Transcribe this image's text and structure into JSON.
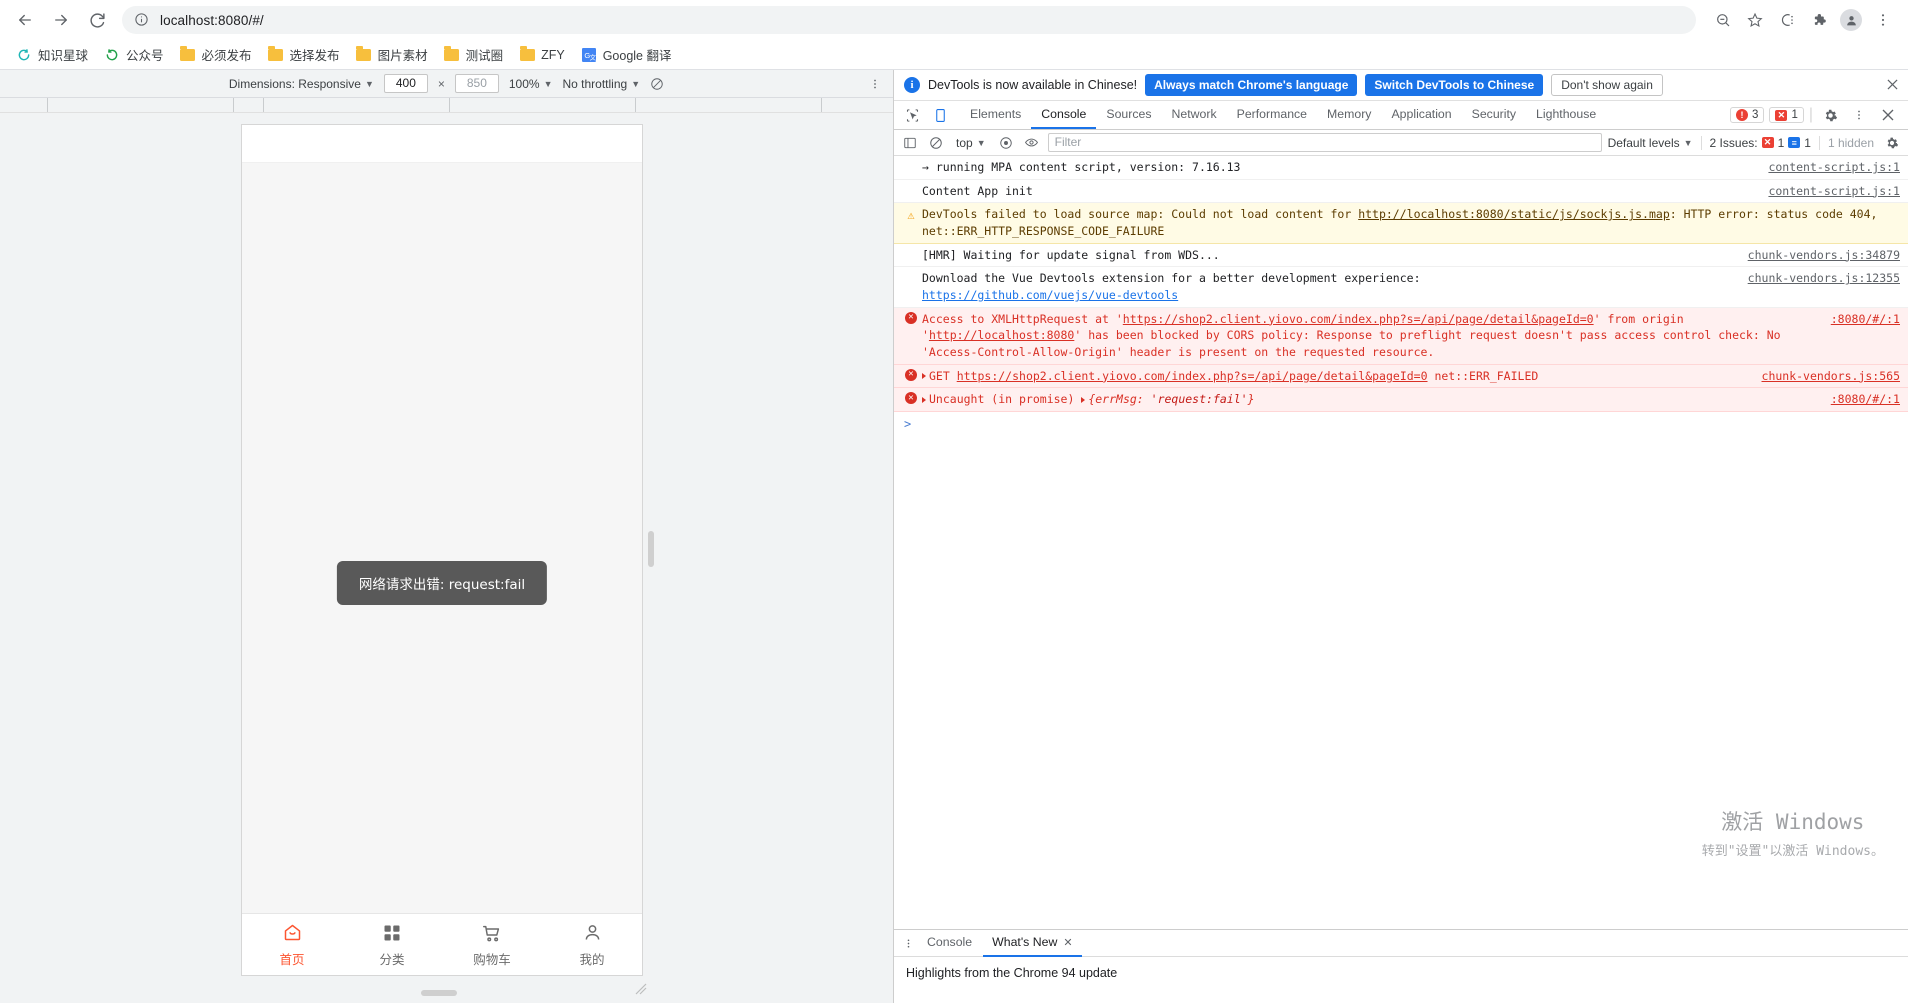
{
  "browser": {
    "back_label": "back-arrow",
    "forward_label": "forward-arrow",
    "reload_label": "reload",
    "url": "localhost:8080/#/",
    "url_host": "localhost:8080",
    "url_path": "/#/",
    "bookmarks": [
      {
        "label": "知识星球",
        "icon": "circle-teal-icon"
      },
      {
        "label": "公众号",
        "icon": "circle-green-icon"
      },
      {
        "label": "必须发布",
        "icon": "folder-icon"
      },
      {
        "label": "选择发布",
        "icon": "folder-icon"
      },
      {
        "label": "图片素材",
        "icon": "folder-icon"
      },
      {
        "label": "测试圈",
        "icon": "folder-icon"
      },
      {
        "label": "ZFY",
        "icon": "folder-icon"
      },
      {
        "label": "Google 翻译",
        "icon": "google-translate-icon"
      }
    ],
    "toolbar_icons": [
      "zoom-out-icon",
      "bookmark-star-icon",
      "extension-badge-icon",
      "puzzle-icon",
      "profile-avatar-icon",
      "chrome-menu-icon"
    ]
  },
  "device_toolbar": {
    "dimensions_label": "Dimensions: Responsive",
    "width": "400",
    "height": "850",
    "x_separator": "×",
    "zoom": "100%",
    "throttling": "No throttling",
    "rotate_icon": "rotate-icon",
    "more_icon": "more-options-icon"
  },
  "phone": {
    "toast": "网络请求出错: request:fail",
    "tabbar": [
      {
        "label": "首页",
        "icon": "home-icon",
        "active": true
      },
      {
        "label": "分类",
        "icon": "grid-icon",
        "active": false
      },
      {
        "label": "购物车",
        "icon": "cart-icon",
        "active": false
      },
      {
        "label": "我的",
        "icon": "person-icon",
        "active": false
      }
    ]
  },
  "devtools": {
    "banner": {
      "message": "DevTools is now available in Chinese!",
      "primary_button": "Always match Chrome's language",
      "secondary_button": "Switch DevTools to Chinese",
      "tertiary_button": "Don't show again",
      "close_icon": "close-icon"
    },
    "tabs": [
      {
        "label": "Elements",
        "selected": false
      },
      {
        "label": "Console",
        "selected": true
      },
      {
        "label": "Sources",
        "selected": false
      },
      {
        "label": "Network",
        "selected": false
      },
      {
        "label": "Performance",
        "selected": false
      },
      {
        "label": "Memory",
        "selected": false
      },
      {
        "label": "Application",
        "selected": false
      },
      {
        "label": "Security",
        "selected": false
      },
      {
        "label": "Lighthouse",
        "selected": false
      }
    ],
    "tab_counters": {
      "errors": "3",
      "messages": "1"
    },
    "filter_bar": {
      "context": "top",
      "filter_placeholder": "Filter",
      "levels": "Default levels",
      "issues_label": "2 Issues:",
      "issues_errors": "1",
      "issues_info": "1",
      "hidden": "1 hidden",
      "settings_icon": "gear-icon",
      "sidebar_icon": "console-sidebar-icon",
      "clear_icon": "clear-console-icon",
      "eye_icon": "live-expression-icon"
    },
    "messages": [
      {
        "level": "log",
        "text": "→ running MPA content script, version: 7.16.13",
        "source": "content-script.js:1"
      },
      {
        "level": "log",
        "text": "Content App init",
        "source": "content-script.js:1"
      },
      {
        "level": "warn",
        "text_pre": "DevTools failed to load source map: Could not load content for ",
        "link": "http://localhost:8080/static/js/sockjs.js.map",
        "text_post": ": HTTP error: status code 404, net::ERR_HTTP_RESPONSE_CODE_FAILURE",
        "source": ""
      },
      {
        "level": "log",
        "text": "[HMR] Waiting for update signal from WDS...",
        "source": "chunk-vendors.js:34879"
      },
      {
        "level": "log",
        "text_pre": "Download the Vue Devtools extension for a better development experience:",
        "link": "https://github.com/vuejs/vue-devtools",
        "text_post": "",
        "source": "chunk-vendors.js:12355"
      },
      {
        "level": "error",
        "text_pre": "Access to XMLHttpRequest at '",
        "link": "https://shop2.client.yiovo.com/index.php?s=/api/page/detail&pageId=0",
        "text_mid": "' from origin '",
        "link2": "http://localhost:8080",
        "text_post": "' has been blocked by CORS policy: Response to preflight request doesn't pass access control check: No 'Access-Control-Allow-Origin' header is present on the requested resource.",
        "source": ":8080/#/:1"
      },
      {
        "level": "error",
        "prefix": "GET ",
        "link": "https://shop2.client.yiovo.com/index.php?s=/api/page/detail&pageId=0",
        "suffix": " net::ERR_FAILED",
        "source": "chunk-vendors.js:565"
      },
      {
        "level": "error",
        "prefix": "Uncaught (in promise) ",
        "object_open": "{errMsg: ",
        "object_value": "'request:fail'",
        "object_close": "}",
        "source": ":8080/#/:1"
      }
    ],
    "prompt": ">",
    "drawer": {
      "kebab_icon": "more-tools-icon",
      "tabs": [
        {
          "label": "Console",
          "selected": false,
          "closable": false
        },
        {
          "label": "What's New",
          "selected": true,
          "closable": true
        }
      ],
      "content_heading": "Highlights from the Chrome 94 update"
    }
  },
  "watermark": {
    "line1": "激活 Windows",
    "line2": "转到\"设置\"以激活 Windows。"
  }
}
